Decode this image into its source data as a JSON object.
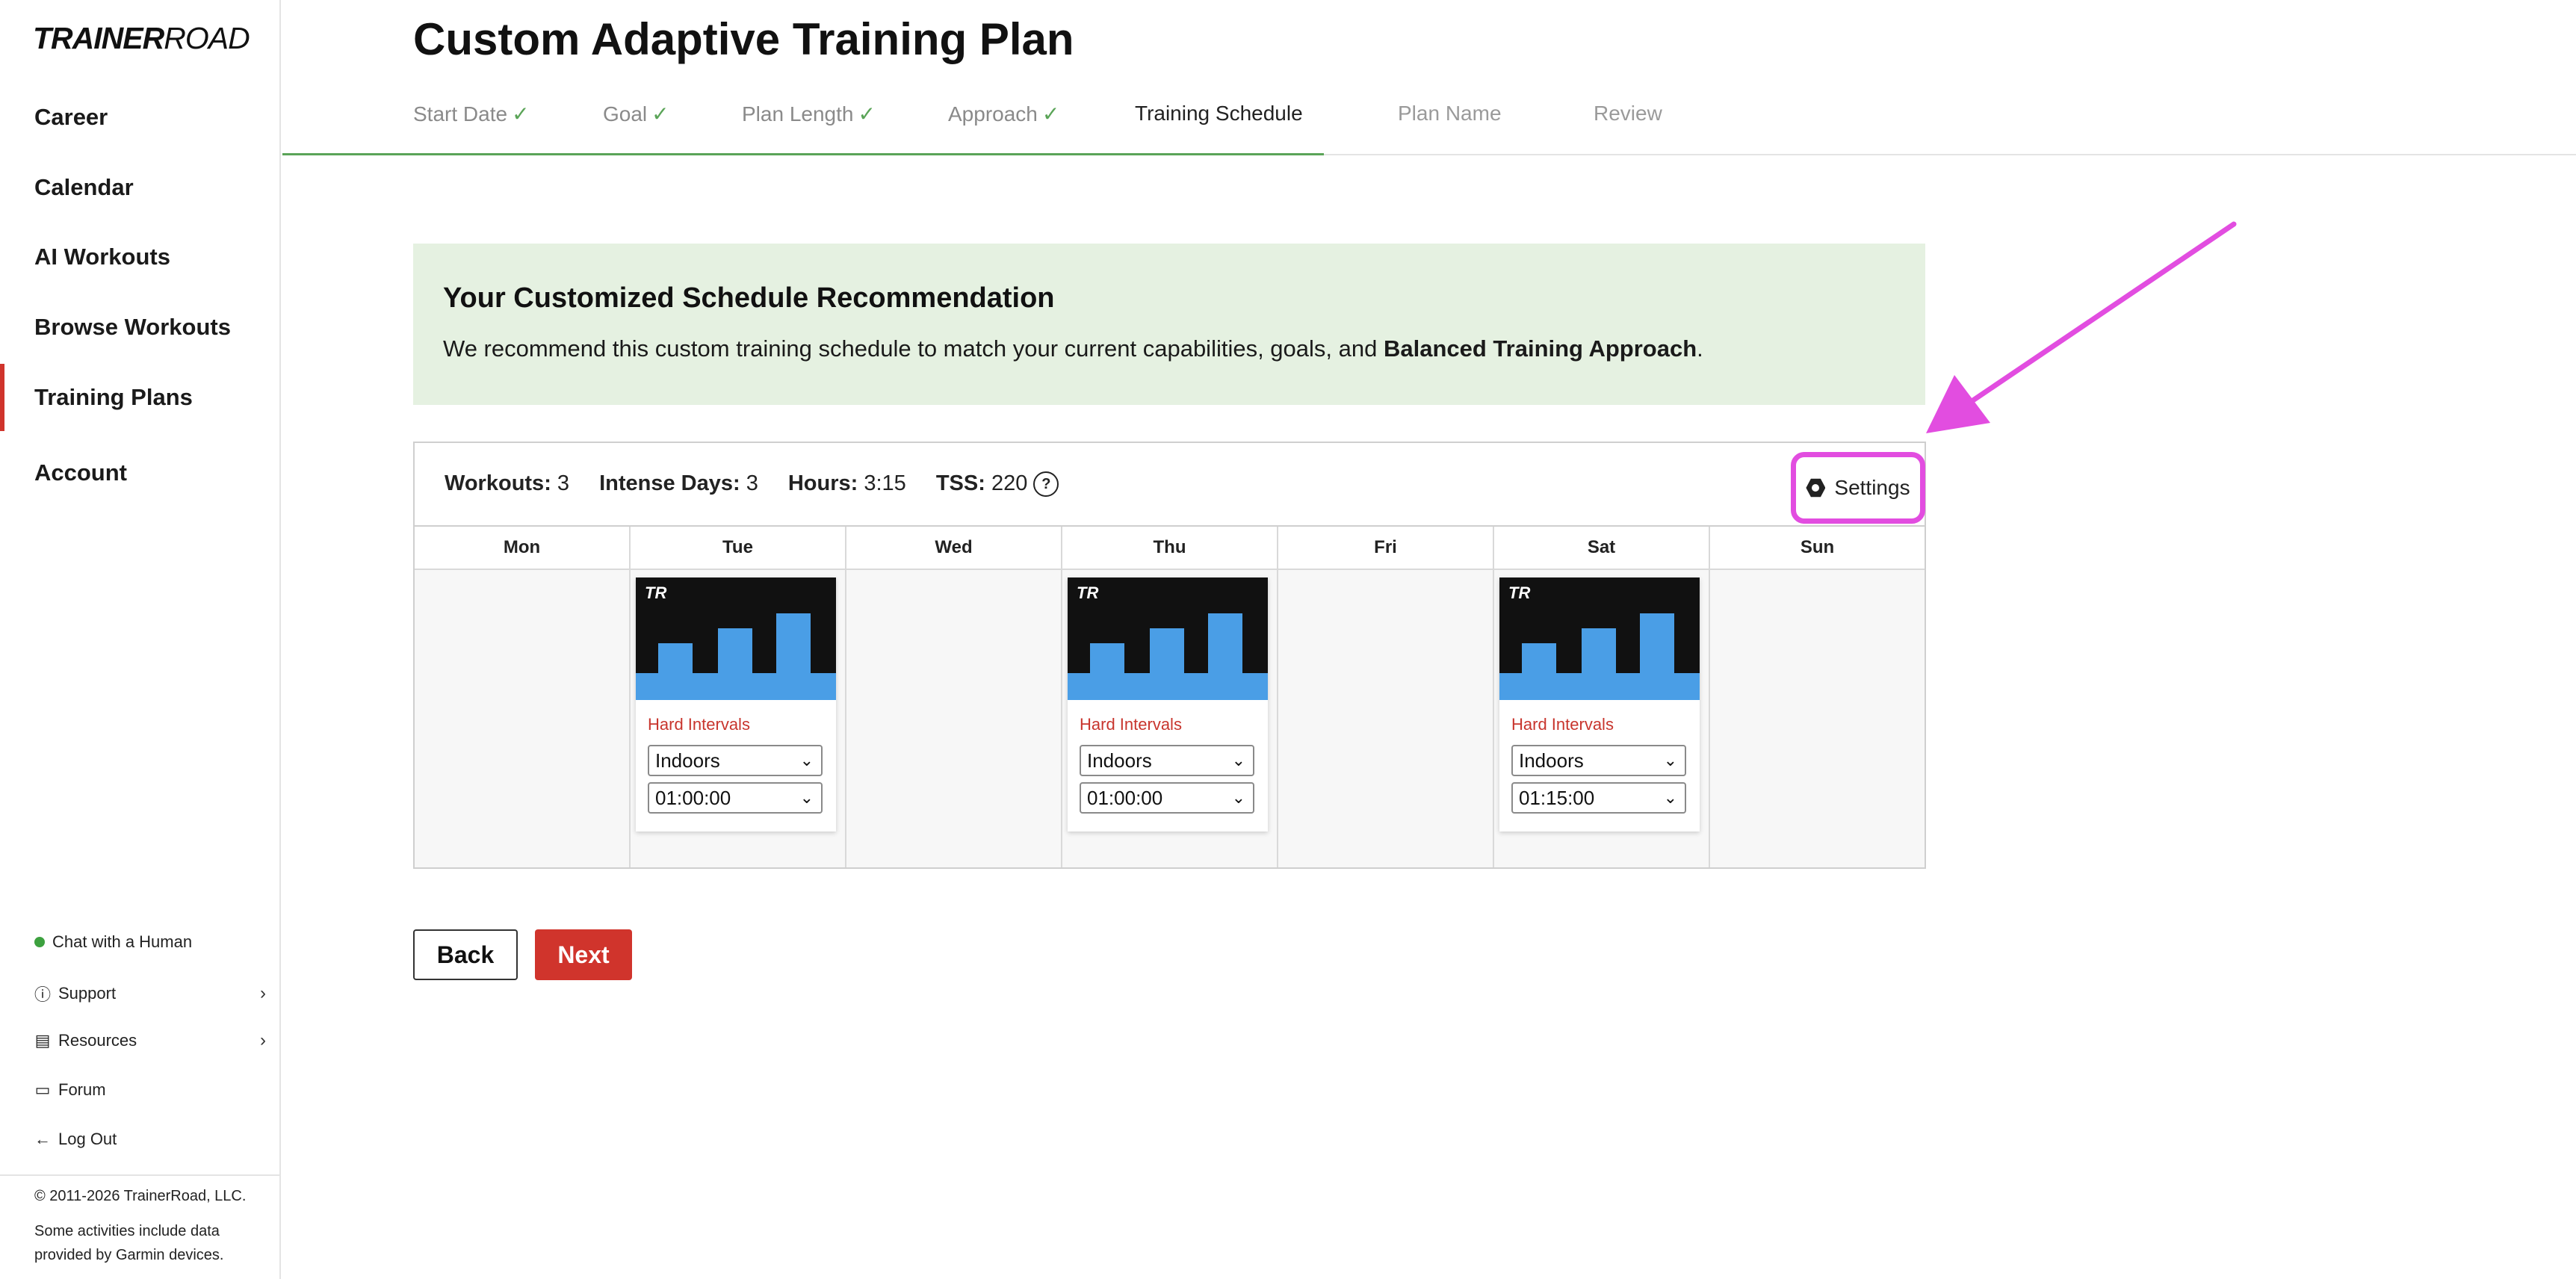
{
  "sidebar": {
    "logo_bold": "TRAINER",
    "logo_light": "ROAD",
    "nav": [
      "Career",
      "Calendar",
      "AI Workouts",
      "Browse Workouts",
      "Training Plans",
      "Account"
    ],
    "footer": {
      "chat": "Chat with a Human",
      "support": "Support",
      "resources": "Resources",
      "forum": "Forum",
      "logout": "Log Out",
      "copyright": "© 2011-2026 TrainerRoad, LLC.",
      "garmin": "Some activities include data provided by Garmin devices."
    }
  },
  "header": {
    "title": "Custom Adaptive Training Plan",
    "steps": [
      {
        "label": "Start Date",
        "state": "done"
      },
      {
        "label": "Goal",
        "state": "done"
      },
      {
        "label": "Plan Length",
        "state": "done"
      },
      {
        "label": "Approach",
        "state": "done"
      },
      {
        "label": "Training Schedule",
        "state": "current"
      },
      {
        "label": "Plan Name",
        "state": "future"
      },
      {
        "label": "Review",
        "state": "future"
      }
    ]
  },
  "banner": {
    "title": "Your Customized Schedule Recommendation",
    "text_prefix": "We recommend this custom training schedule to match your current capabilities, goals, and ",
    "text_bold": "Balanced Training Approach",
    "text_suffix": "."
  },
  "schedule": {
    "stats": {
      "workouts_label": "Workouts:",
      "workouts_value": "3",
      "intense_label": "Intense Days:",
      "intense_value": "3",
      "hours_label": "Hours:",
      "hours_value": "3:15",
      "tss_label": "TSS:",
      "tss_value": "220"
    },
    "settings_label": "Settings",
    "days": [
      "Mon",
      "Tue",
      "Wed",
      "Thu",
      "Fri",
      "Sat",
      "Sun"
    ],
    "workouts": {
      "tue": {
        "logo": "TR",
        "type": "Hard Intervals",
        "location": "Indoors",
        "duration": "01:00:00"
      },
      "thu": {
        "logo": "TR",
        "type": "Hard Intervals",
        "location": "Indoors",
        "duration": "01:00:00"
      },
      "sat": {
        "logo": "TR",
        "type": "Hard Intervals",
        "location": "Indoors",
        "duration": "01:15:00"
      }
    }
  },
  "buttons": {
    "back": "Back",
    "next": "Next"
  },
  "colors": {
    "accent_red": "#d0342c",
    "success_green": "#5aa457",
    "banner_bg": "#e5f1e1",
    "annotation_magenta": "#e24de0",
    "workout_bar_blue": "#4a9ee6"
  }
}
